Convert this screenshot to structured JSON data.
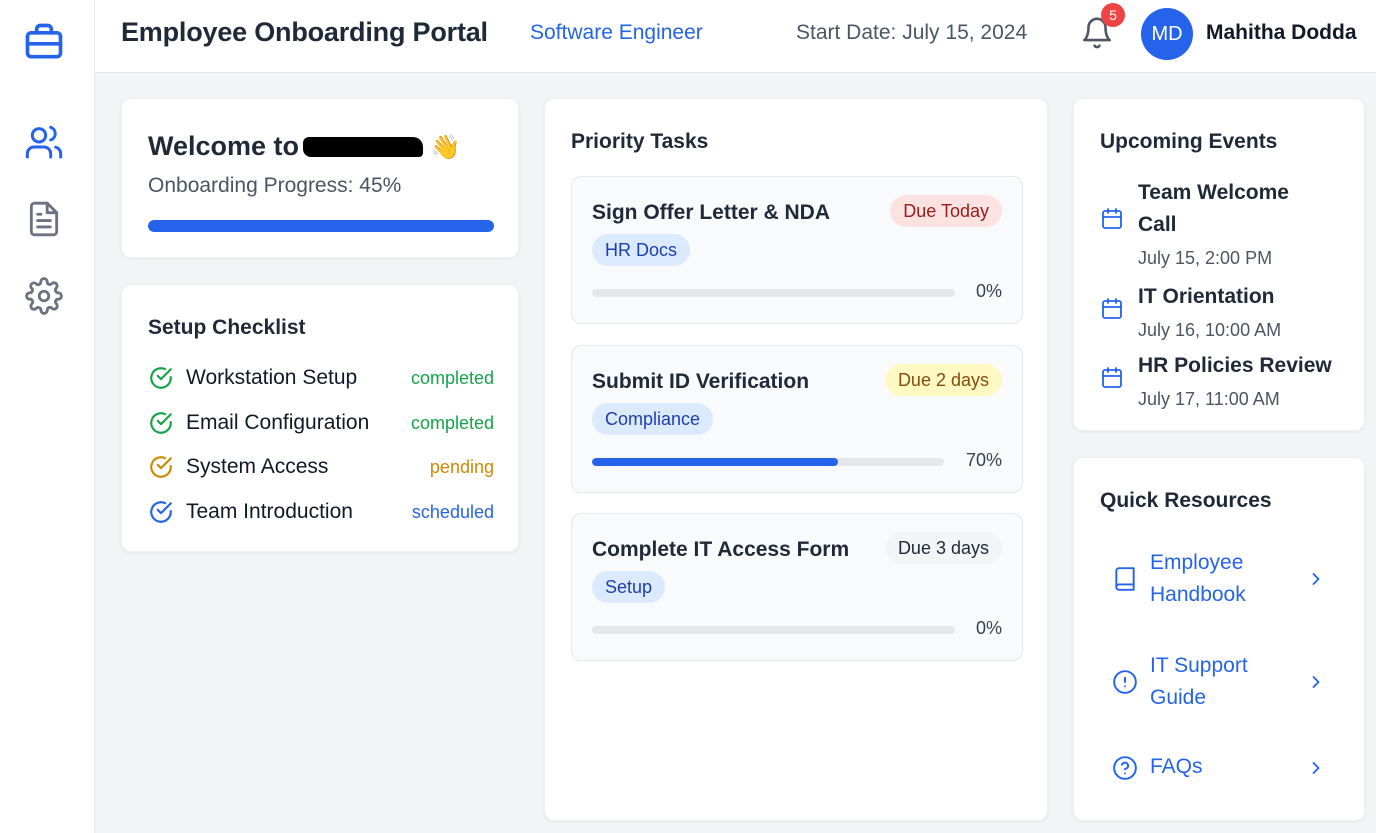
{
  "header": {
    "title": "Employee Onboarding Portal",
    "role": "Software Engineer",
    "start_date": "Start Date: July 15, 2024",
    "notification_count": "5",
    "avatar_initials": "MD",
    "user_name": "Mahitha Dodda"
  },
  "sidebar": {
    "items": [
      {
        "icon": "briefcase-icon"
      },
      {
        "icon": "users-icon"
      },
      {
        "icon": "document-icon"
      },
      {
        "icon": "gear-icon"
      }
    ]
  },
  "welcome": {
    "title_prefix": "Welcome to",
    "emoji": "👋",
    "progress_label": "Onboarding Progress: 45%",
    "progress_fraction": 1.0
  },
  "checklist": {
    "heading": "Setup Checklist",
    "items": [
      {
        "label": "Workstation Setup",
        "status": "completed",
        "color": "#16a34a"
      },
      {
        "label": "Email Configuration",
        "status": "completed",
        "color": "#16a34a"
      },
      {
        "label": "System Access",
        "status": "pending",
        "color": "#ca8a04"
      },
      {
        "label": "Team Introduction",
        "status": "scheduled",
        "color": "#2563eb"
      }
    ]
  },
  "tasks": {
    "heading": "Priority Tasks",
    "items": [
      {
        "title": "Sign Offer Letter & NDA",
        "due": "Due Today",
        "due_bg": "#fde2e2",
        "due_color": "#991b1b",
        "tag": "HR Docs",
        "progress": 0,
        "progress_label": "0%"
      },
      {
        "title": "Submit ID Verification",
        "due": "Due 2 days",
        "due_bg": "#fef9c3",
        "due_color": "#854d0e",
        "tag": "Compliance",
        "progress": 70,
        "progress_label": "70%"
      },
      {
        "title": "Complete IT Access Form",
        "due": "Due 3 days",
        "due_bg": "#f3f4f6",
        "due_color": "#1f2937",
        "tag": "Setup",
        "progress": 0,
        "progress_label": "0%"
      }
    ]
  },
  "events": {
    "heading": "Upcoming Events",
    "items": [
      {
        "title": "Team Welcome Call",
        "date": "July 15, 2:00 PM"
      },
      {
        "title": "IT Orientation",
        "date": "July 16, 10:00 AM"
      },
      {
        "title": "HR Policies Review",
        "date": "July 17, 11:00 AM"
      }
    ]
  },
  "resources": {
    "heading": "Quick Resources",
    "items": [
      {
        "label": "Employee Handbook",
        "icon": "book-icon"
      },
      {
        "label": "IT Support Guide",
        "icon": "alert-circle-icon"
      },
      {
        "label": "FAQs",
        "icon": "help-circle-icon"
      }
    ]
  },
  "colors": {
    "accent": "#2563eb",
    "badge": "#ef4444"
  }
}
